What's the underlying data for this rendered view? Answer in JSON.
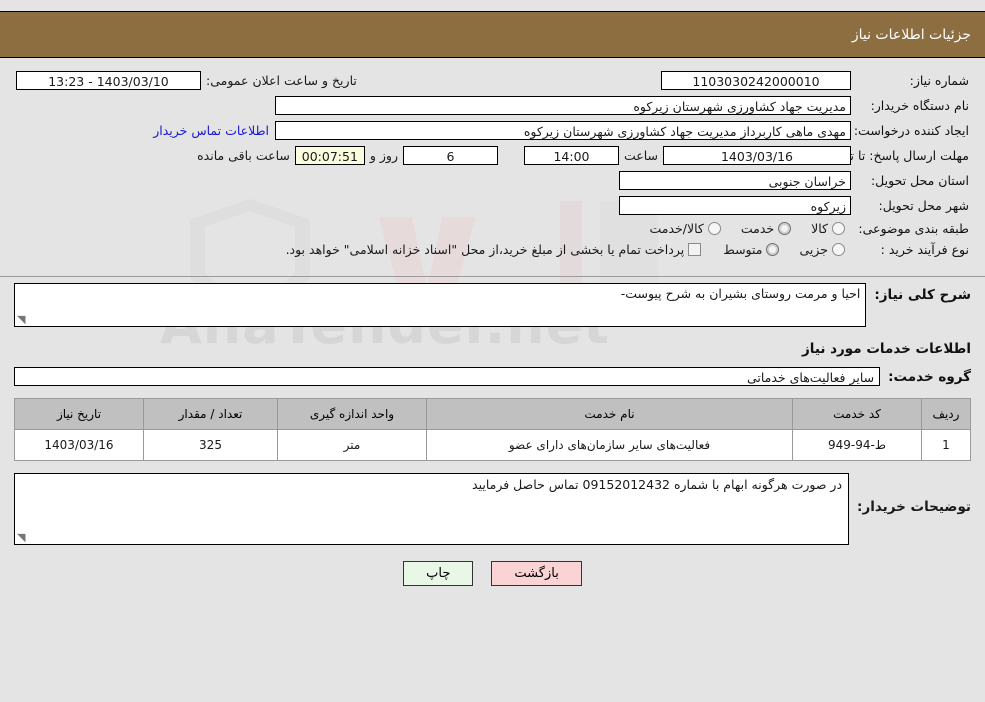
{
  "header": {
    "title": "جزئیات اطلاعات نیاز"
  },
  "watermark": {
    "text": "AnaTender.net"
  },
  "form": {
    "need_number_label": "شماره نیاز:",
    "need_number_value": "1103030242000010",
    "announce_datetime_label": "تاریخ و ساعت اعلان عمومی:",
    "announce_datetime_value": "1403/03/10 - 13:23",
    "buyer_org_label": "نام دستگاه خریدار:",
    "buyer_org_value": "مدیریت جهاد کشاورزی شهرستان زیرکوه",
    "creator_label": "ایجاد کننده درخواست:",
    "creator_value": "مهدی ماهی کاربرداز مدیریت جهاد کشاورزی شهرستان زیرکوه",
    "contact_link": "اطلاعات تماس خریدار",
    "deadline_label": "مهلت ارسال پاسخ: تا تاریخ:",
    "deadline_date": "1403/03/16",
    "hour_label": "ساعت",
    "deadline_hour": "14:00",
    "days_value": "6",
    "days_label": "روز و",
    "countdown_value": "00:07:51",
    "countdown_label": "ساعت باقی مانده",
    "province_label": "استان محل تحویل:",
    "province_value": "خراسان جنوبی",
    "city_label": "شهر محل تحویل:",
    "city_value": "زیرکوه",
    "category_label": "طبقه بندی موضوعی:",
    "category_options": [
      {
        "label": "کالا",
        "selected": false
      },
      {
        "label": "خدمت",
        "selected": true
      },
      {
        "label": "کالا/خدمت",
        "selected": false
      }
    ],
    "process_label": "نوع فرآیند خرید :",
    "process_options": [
      {
        "label": "جزیی",
        "selected": false
      },
      {
        "label": "متوسط",
        "selected": true
      }
    ],
    "treasury_checkbox_label": "پرداخت تمام یا بخشی از مبلغ خرید،از محل \"اسناد خزانه اسلامی\" خواهد بود.",
    "treasury_checked": false
  },
  "description": {
    "label": "شرح کلی نیاز:",
    "value": "احیا و مرمت روستای بشیران به شرح پیوست-"
  },
  "services_section": {
    "heading": "اطلاعات خدمات مورد نیاز",
    "group_label": "گروه خدمت:",
    "group_value": "سایر فعالیت‌های خدماتی"
  },
  "table": {
    "columns": [
      "ردیف",
      "کد خدمت",
      "نام خدمت",
      "واحد اندازه گیری",
      "تعداد / مقدار",
      "تاریخ نیاز"
    ],
    "rows": [
      {
        "row": "1",
        "service_code": "ط-94-949",
        "service_name": "فعالیت‌های سایر سازمان‌های دارای عضو",
        "unit": "متر",
        "quantity": "325",
        "need_date": "1403/03/16"
      }
    ]
  },
  "notes": {
    "label": "توضیحات خریدار:",
    "value": "در صورت هرگونه ابهام با شماره 09152012432 تماس حاصل فرمایید"
  },
  "buttons": {
    "print": "چاپ",
    "back": "بازگشت"
  },
  "colors": {
    "header_bg": "#8d6e41",
    "page_bg": "#e4e4e4",
    "link": "#1717d6",
    "print_btn": "#e9f7e6",
    "back_btn": "#fad4d4",
    "countdown_bg": "#fbfbdd"
  }
}
